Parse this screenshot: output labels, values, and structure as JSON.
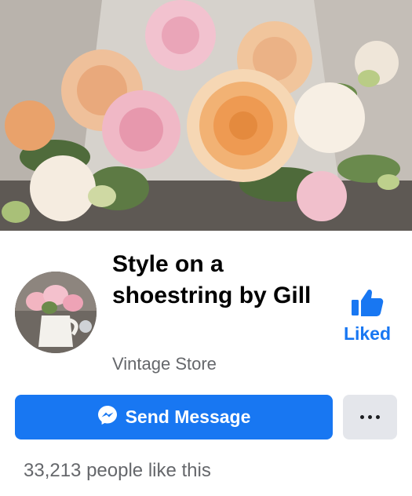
{
  "cover": {
    "image": "cover-photo-roses"
  },
  "page": {
    "avatar": "profile-photo-roses-in-jug",
    "title": "Style on a shoestring by Gill",
    "category": "Vintage Store"
  },
  "like": {
    "icon": "thumbs-up-icon",
    "label": "Liked",
    "color": "#1877f2"
  },
  "actions": {
    "send_message_label": "Send Message",
    "send_message_icon": "messenger-icon",
    "more_icon": "more-dots-icon",
    "primary_color": "#1877f2",
    "secondary_color": "#e4e6eb"
  },
  "stats": {
    "likes_text": "33,213 people like this"
  }
}
